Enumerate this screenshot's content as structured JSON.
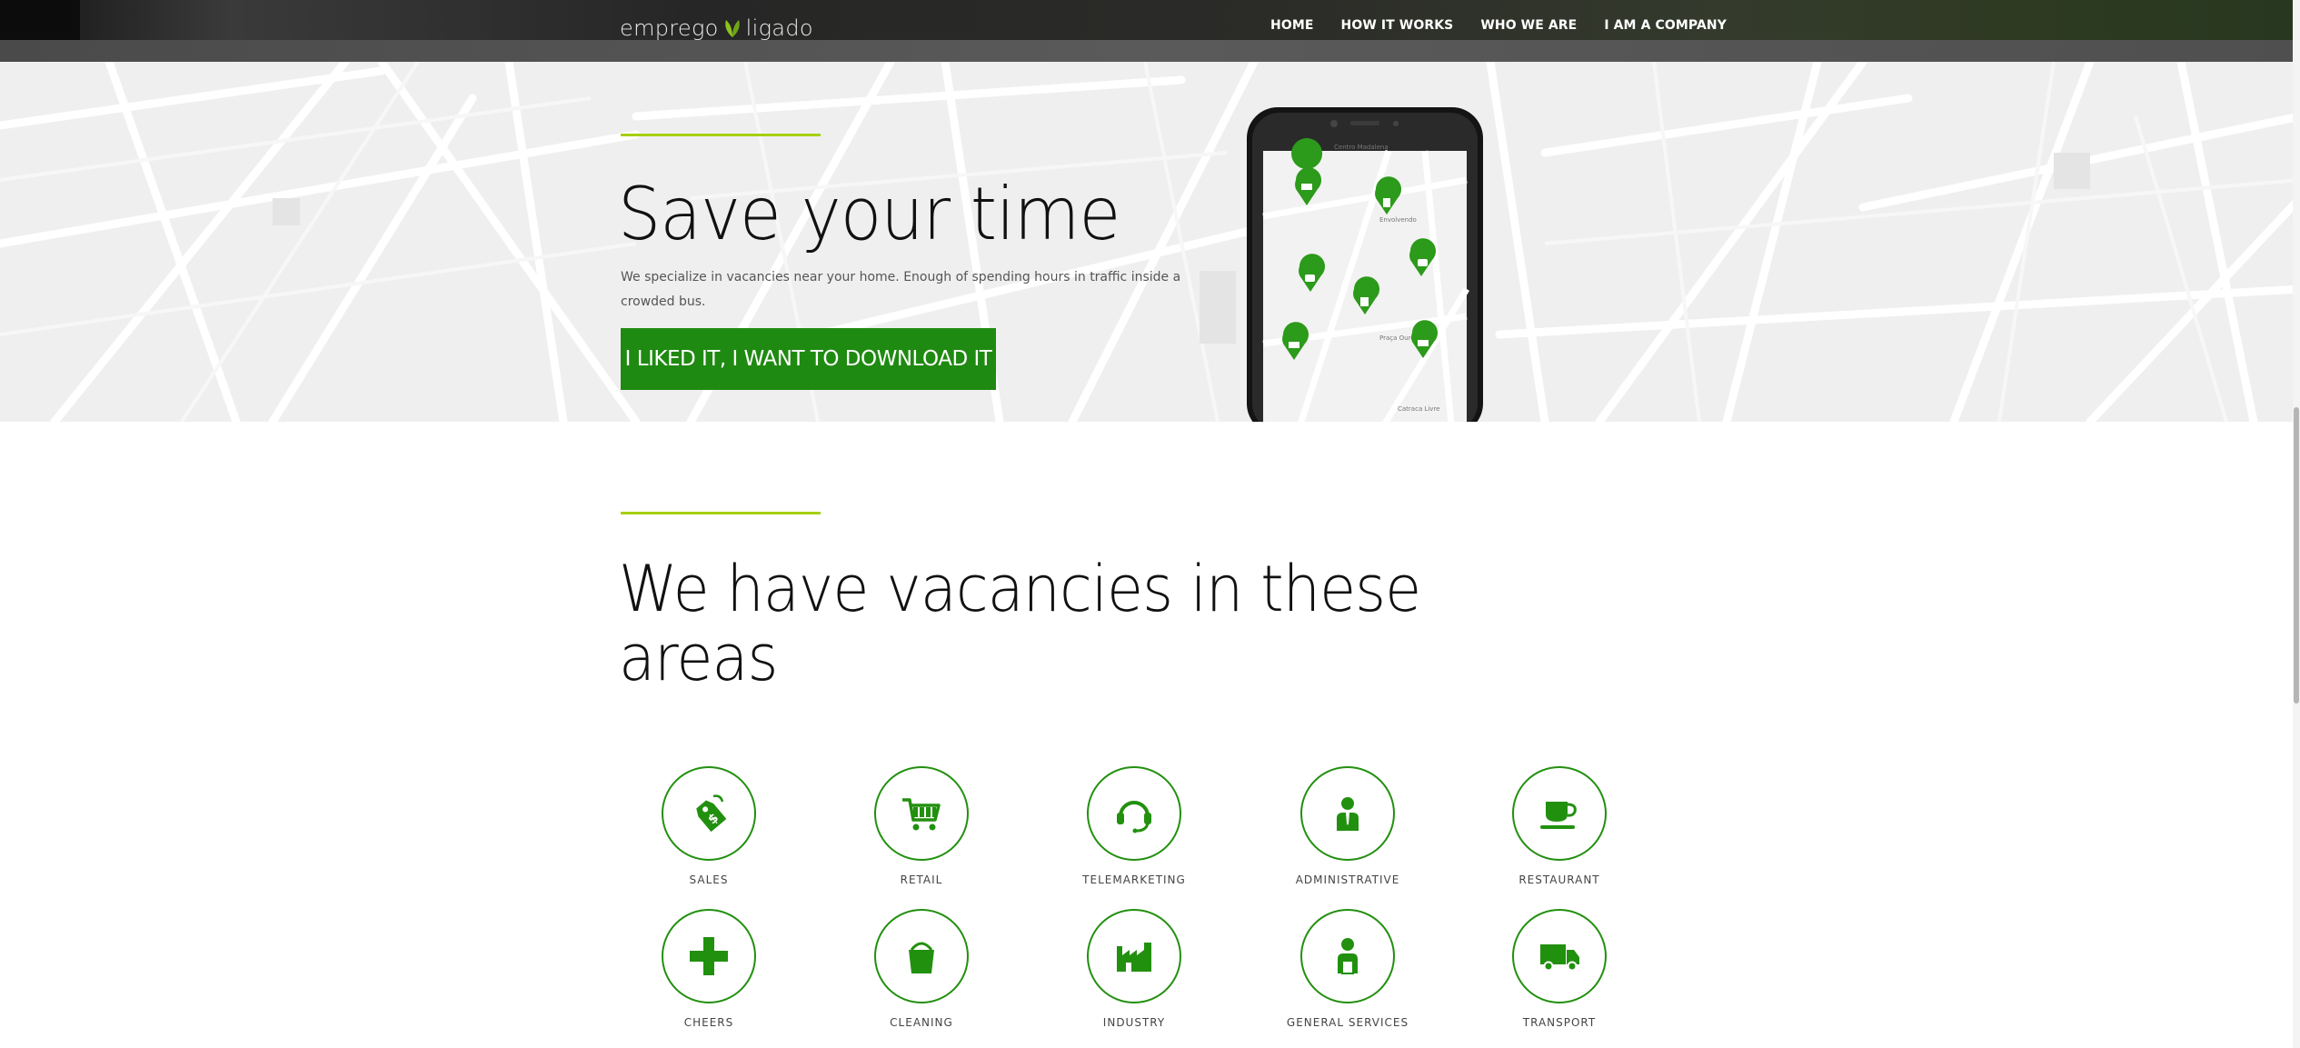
{
  "header": {
    "logo_left": "emprego",
    "logo_right": "ligado",
    "nav": [
      "HOME",
      "HOW IT WORKS",
      "WHO WE ARE",
      "I AM A COMPANY"
    ]
  },
  "hero": {
    "title": "Save your time",
    "text": "We specialize in vacancies near your home. Enough of spending hours in traffic inside a crowded bus.",
    "cta_label": "I LIKED IT, I WANT TO DOWNLOAD IT"
  },
  "vacancies": {
    "title": "We have vacancies in these areas",
    "areas": [
      {
        "label": "SALES",
        "icon": "price-tag-icon"
      },
      {
        "label": "RETAIL",
        "icon": "shopping-cart-icon"
      },
      {
        "label": "TELEMARKETING",
        "icon": "headset-icon"
      },
      {
        "label": "ADMINISTRATIVE",
        "icon": "businessman-icon"
      },
      {
        "label": "RESTAURANT",
        "icon": "coffee-cup-icon"
      },
      {
        "label": "CHEERS",
        "icon": "health-cross-icon"
      },
      {
        "label": "CLEANING",
        "icon": "bucket-icon"
      },
      {
        "label": "INDUSTRY",
        "icon": "factory-icon"
      },
      {
        "label": "GENERAL SERVICES",
        "icon": "worker-icon"
      },
      {
        "label": "TRANSPORT",
        "icon": "truck-icon"
      }
    ]
  },
  "colors": {
    "brand_green": "#1f8a11",
    "accent_lime": "#a6cf12",
    "icon_green": "#22900f"
  }
}
